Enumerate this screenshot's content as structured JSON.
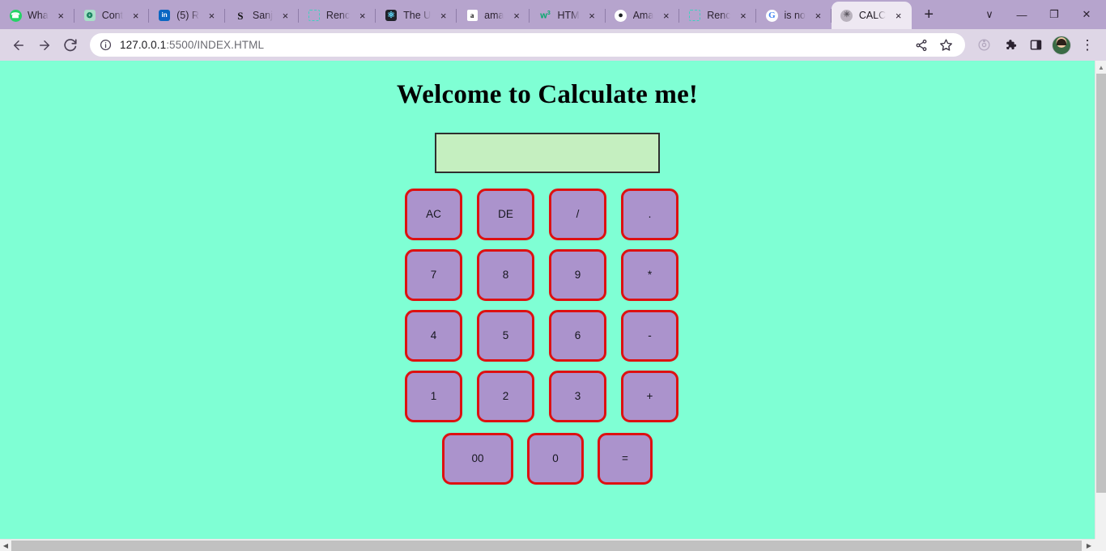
{
  "browser": {
    "tabs": [
      {
        "title": "Wha",
        "icon": "whatsapp-icon",
        "active": false
      },
      {
        "title": "Cont",
        "icon": "chatgpt-icon",
        "active": false
      },
      {
        "title": "(5) R",
        "icon": "linkedin-icon",
        "active": false
      },
      {
        "title": "Sanj",
        "icon": "scaler-s-icon",
        "active": false
      },
      {
        "title": "Renc",
        "icon": "dashed-square-icon",
        "active": false
      },
      {
        "title": "The U",
        "icon": "react-icon",
        "active": false
      },
      {
        "title": "ama",
        "icon": "amazon-icon",
        "active": false
      },
      {
        "title": "HTM",
        "icon": "w3schools-icon",
        "active": false
      },
      {
        "title": "Ama",
        "icon": "github-icon",
        "active": false
      },
      {
        "title": "Renc",
        "icon": "dashed-square-icon",
        "active": false
      },
      {
        "title": "is no",
        "icon": "google-icon",
        "active": false
      },
      {
        "title": "CALC",
        "icon": "globe-icon",
        "active": true
      }
    ],
    "new_tab_label": "+",
    "tab_close_label": "×",
    "window_controls": {
      "tab_search_label": "∨",
      "minimize_label": "—",
      "maximize_label": "❐",
      "close_label": "✕"
    },
    "toolbar": {
      "back_label": "back-arrow",
      "forward_label": "forward-arrow",
      "reload_label": "reload",
      "site_info_label": "ⓘ",
      "url_host": "127.0.0.1",
      "url_path": ":5500/INDEX.HTML",
      "share_label": "share-icon",
      "bookmark_label": "☆",
      "profile_sync_label": "sync-icon",
      "extensions_label": "extensions-icon",
      "sidepanel_label": "side-panel-icon",
      "avatar_label": "user-avatar",
      "menu_label": "⋮"
    }
  },
  "page": {
    "title": "Welcome to Calculate me!",
    "display": {
      "value": "",
      "placeholder": ""
    },
    "keypad": {
      "rows": [
        [
          {
            "label": "AC",
            "name": "key-all-clear"
          },
          {
            "label": "DE",
            "name": "key-delete"
          },
          {
            "label": "/",
            "name": "key-divide"
          },
          {
            "label": ".",
            "name": "key-decimal"
          }
        ],
        [
          {
            "label": "7",
            "name": "key-7"
          },
          {
            "label": "8",
            "name": "key-8"
          },
          {
            "label": "9",
            "name": "key-9"
          },
          {
            "label": "*",
            "name": "key-multiply"
          }
        ],
        [
          {
            "label": "4",
            "name": "key-4"
          },
          {
            "label": "5",
            "name": "key-5"
          },
          {
            "label": "6",
            "name": "key-6"
          },
          {
            "label": "-",
            "name": "key-subtract"
          }
        ],
        [
          {
            "label": "1",
            "name": "key-1"
          },
          {
            "label": "2",
            "name": "key-2"
          },
          {
            "label": "3",
            "name": "key-3"
          },
          {
            "label": "+",
            "name": "key-add"
          }
        ]
      ],
      "last_row": [
        {
          "label": "00",
          "name": "key-double-zero"
        },
        {
          "label": "0",
          "name": "key-0"
        },
        {
          "label": "=",
          "name": "key-equals"
        }
      ]
    }
  },
  "colors": {
    "page_background": "#7fffd4",
    "display_background": "#c5efc0",
    "key_background": "#ab93cc",
    "key_border": "#dd1111",
    "chrome_tabstrip": "#b6a4cd",
    "chrome_toolbar": "#ded6e6",
    "active_tab": "#eee8f2"
  }
}
